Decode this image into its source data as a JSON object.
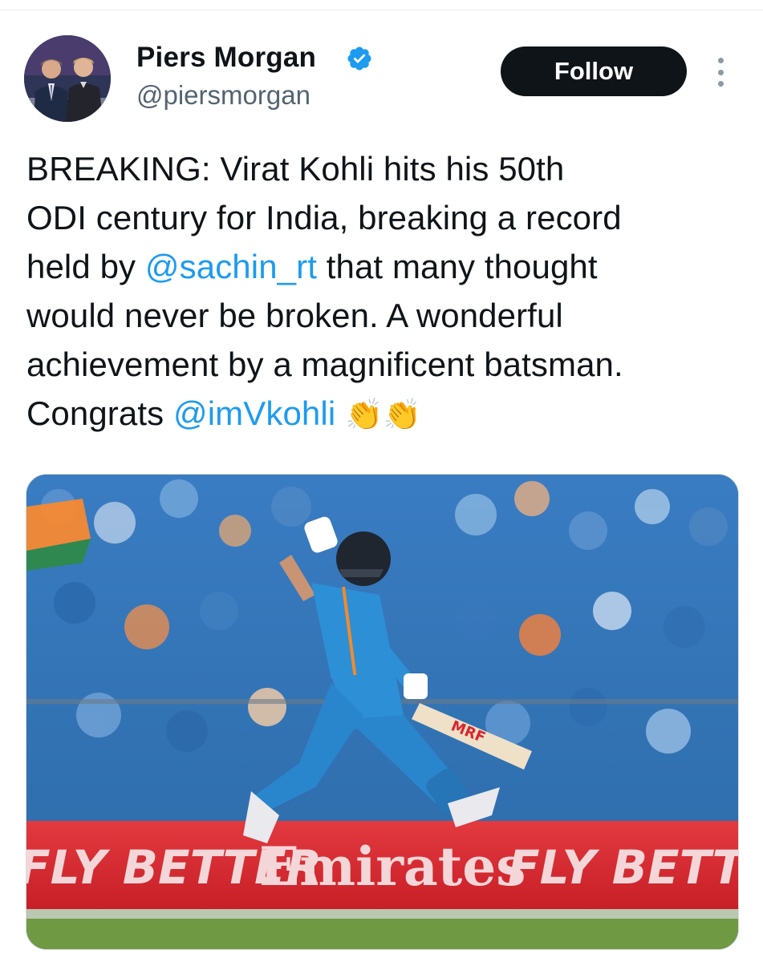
{
  "tweet": {
    "author": {
      "name": "Piers Morgan",
      "handle": "@piersmorgan",
      "verified": true,
      "verified_color": "#1d9bf0"
    },
    "follow_label": "Follow",
    "text": {
      "line1": "BREAKING: Virat Kohli hits his 50th",
      "line2": "ODI century for India, breaking a record",
      "line3_pre": "held by ",
      "line3_mention": "@sachin_rt",
      "line3_post": " that many thought",
      "line4": "would never be broken. A wonderful",
      "line5": "achievement by a magnificent batsman.",
      "line6_pre": "Congrats ",
      "line6_mention": "@imVkohli",
      "emoji": "👏👏"
    },
    "media": {
      "banner_text_left": "FLY BETTER",
      "banner_text_center": "Emirates",
      "banner_text_right": "FLY BETTER",
      "bat_logo": "MRF"
    },
    "colors": {
      "text": "#0f1419",
      "secondary": "#536471",
      "link": "#1d9bf0",
      "follow_bg": "#0f1419",
      "jersey": "#2d8fd6",
      "banner": "#d8262e"
    }
  }
}
